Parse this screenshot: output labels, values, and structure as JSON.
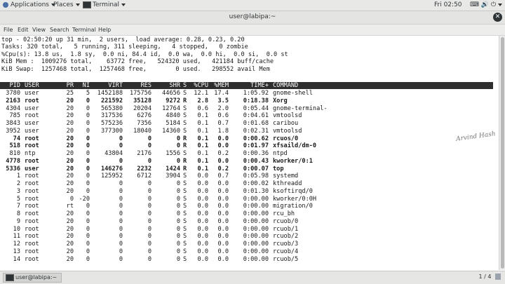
{
  "topbar": {
    "applications": "Applications",
    "places": "Places",
    "terminal": "Terminal",
    "clock": "Fri 02:50"
  },
  "window": {
    "title": "user@labipa:~"
  },
  "menu": [
    "File",
    "Edit",
    "View",
    "Search",
    "Terminal",
    "Help"
  ],
  "summary": [
    "top - 02:50:20 up 31 min,  2 users,  load average: 0.28, 0.23, 0.20",
    "Tasks: 320 total,   5 running, 311 sleeping,   4 stopped,   0 zombie",
    "%Cpu(s): 13.8 us,  1.8 sy,  0.0 ni, 84.4 id,  0.0 wa,  0.0 hi,  0.0 si,  0.0 st",
    "KiB Mem :  1009276 total,    63772 free,   524320 used,   421184 buff/cache",
    "KiB Swap:  1257468 total,  1257468 free,        0 used.   298552 avail Mem"
  ],
  "columns": [
    "PID",
    "USER",
    "PR",
    "NI",
    "VIRT",
    "RES",
    "SHR",
    "S",
    "%CPU",
    "%MEM",
    "TIME+",
    "COMMAND"
  ],
  "processes": [
    {
      "pid": "3780",
      "user": "user",
      "pr": "25",
      "ni": "5",
      "virt": "1452188",
      "res": "175756",
      "shr": "44656",
      "s": "S",
      "cpu": "12.1",
      "mem": "17.4",
      "time": "1:05.92",
      "cmd": "gnome-shell",
      "bold": false
    },
    {
      "pid": "2163",
      "user": "root",
      "pr": "20",
      "ni": "0",
      "virt": "221592",
      "res": "35128",
      "shr": "9272",
      "s": "R",
      "cpu": "2.8",
      "mem": "3.5",
      "time": "0:18.38",
      "cmd": "Xorg",
      "bold": true
    },
    {
      "pid": "4304",
      "user": "user",
      "pr": "20",
      "ni": "0",
      "virt": "565380",
      "res": "20204",
      "shr": "12764",
      "s": "S",
      "cpu": "0.6",
      "mem": "2.0",
      "time": "0:05.44",
      "cmd": "gnome-terminal-",
      "bold": false
    },
    {
      "pid": "785",
      "user": "root",
      "pr": "20",
      "ni": "0",
      "virt": "317536",
      "res": "6276",
      "shr": "4840",
      "s": "S",
      "cpu": "0.1",
      "mem": "0.6",
      "time": "0:04.61",
      "cmd": "vmtoolsd",
      "bold": false
    },
    {
      "pid": "3843",
      "user": "user",
      "pr": "20",
      "ni": "0",
      "virt": "575236",
      "res": "7356",
      "shr": "5184",
      "s": "S",
      "cpu": "0.1",
      "mem": "0.7",
      "time": "0:01.68",
      "cmd": "caribou",
      "bold": false
    },
    {
      "pid": "3952",
      "user": "user",
      "pr": "20",
      "ni": "0",
      "virt": "377300",
      "res": "18040",
      "shr": "14360",
      "s": "S",
      "cpu": "0.1",
      "mem": "1.8",
      "time": "0:02.31",
      "cmd": "vmtoolsd",
      "bold": false
    },
    {
      "pid": "74",
      "user": "root",
      "pr": "20",
      "ni": "0",
      "virt": "0",
      "res": "0",
      "shr": "0",
      "s": "R",
      "cpu": "0.1",
      "mem": "0.0",
      "time": "0:00.62",
      "cmd": "rcuos/0",
      "bold": true
    },
    {
      "pid": "518",
      "user": "root",
      "pr": "20",
      "ni": "0",
      "virt": "0",
      "res": "0",
      "shr": "0",
      "s": "R",
      "cpu": "0.1",
      "mem": "0.0",
      "time": "0:01.97",
      "cmd": "xfsaild/dm-0",
      "bold": true
    },
    {
      "pid": "810",
      "user": "ntp",
      "pr": "20",
      "ni": "0",
      "virt": "43804",
      "res": "2176",
      "shr": "1556",
      "s": "S",
      "cpu": "0.1",
      "mem": "0.2",
      "time": "0:00.36",
      "cmd": "ntpd",
      "bold": false
    },
    {
      "pid": "4778",
      "user": "root",
      "pr": "20",
      "ni": "0",
      "virt": "0",
      "res": "0",
      "shr": "0",
      "s": "R",
      "cpu": "0.1",
      "mem": "0.0",
      "time": "0:00.43",
      "cmd": "kworker/0:1",
      "bold": true
    },
    {
      "pid": "5336",
      "user": "user",
      "pr": "20",
      "ni": "0",
      "virt": "146276",
      "res": "2232",
      "shr": "1424",
      "s": "R",
      "cpu": "0.1",
      "mem": "0.2",
      "time": "0:00.07",
      "cmd": "top",
      "bold": true
    },
    {
      "pid": "1",
      "user": "root",
      "pr": "20",
      "ni": "0",
      "virt": "125952",
      "res": "6712",
      "shr": "3904",
      "s": "S",
      "cpu": "0.0",
      "mem": "0.7",
      "time": "0:05.98",
      "cmd": "systemd",
      "bold": false
    },
    {
      "pid": "2",
      "user": "root",
      "pr": "20",
      "ni": "0",
      "virt": "0",
      "res": "0",
      "shr": "0",
      "s": "S",
      "cpu": "0.0",
      "mem": "0.0",
      "time": "0:00.02",
      "cmd": "kthreadd",
      "bold": false
    },
    {
      "pid": "3",
      "user": "root",
      "pr": "20",
      "ni": "0",
      "virt": "0",
      "res": "0",
      "shr": "0",
      "s": "S",
      "cpu": "0.0",
      "mem": "0.0",
      "time": "0:01.30",
      "cmd": "ksoftirqd/0",
      "bold": false
    },
    {
      "pid": "5",
      "user": "root",
      "pr": "0",
      "ni": "-20",
      "virt": "0",
      "res": "0",
      "shr": "0",
      "s": "S",
      "cpu": "0.0",
      "mem": "0.0",
      "time": "0:00.00",
      "cmd": "kworker/0:0H",
      "bold": false
    },
    {
      "pid": "7",
      "user": "root",
      "pr": "rt",
      "ni": "0",
      "virt": "0",
      "res": "0",
      "shr": "0",
      "s": "S",
      "cpu": "0.0",
      "mem": "0.0",
      "time": "0:00.00",
      "cmd": "migration/0",
      "bold": false
    },
    {
      "pid": "8",
      "user": "root",
      "pr": "20",
      "ni": "0",
      "virt": "0",
      "res": "0",
      "shr": "0",
      "s": "S",
      "cpu": "0.0",
      "mem": "0.0",
      "time": "0:00.00",
      "cmd": "rcu_bh",
      "bold": false
    },
    {
      "pid": "9",
      "user": "root",
      "pr": "20",
      "ni": "0",
      "virt": "0",
      "res": "0",
      "shr": "0",
      "s": "S",
      "cpu": "0.0",
      "mem": "0.0",
      "time": "0:00.00",
      "cmd": "rcuob/0",
      "bold": false
    },
    {
      "pid": "10",
      "user": "root",
      "pr": "20",
      "ni": "0",
      "virt": "0",
      "res": "0",
      "shr": "0",
      "s": "S",
      "cpu": "0.0",
      "mem": "0.0",
      "time": "0:00.00",
      "cmd": "rcuob/1",
      "bold": false
    },
    {
      "pid": "11",
      "user": "root",
      "pr": "20",
      "ni": "0",
      "virt": "0",
      "res": "0",
      "shr": "0",
      "s": "S",
      "cpu": "0.0",
      "mem": "0.0",
      "time": "0:00.00",
      "cmd": "rcuob/2",
      "bold": false
    },
    {
      "pid": "12",
      "user": "root",
      "pr": "20",
      "ni": "0",
      "virt": "0",
      "res": "0",
      "shr": "0",
      "s": "S",
      "cpu": "0.0",
      "mem": "0.0",
      "time": "0:00.00",
      "cmd": "rcuob/3",
      "bold": false
    },
    {
      "pid": "13",
      "user": "root",
      "pr": "20",
      "ni": "0",
      "virt": "0",
      "res": "0",
      "shr": "0",
      "s": "S",
      "cpu": "0.0",
      "mem": "0.0",
      "time": "0:00.00",
      "cmd": "rcuob/4",
      "bold": false
    },
    {
      "pid": "14",
      "user": "root",
      "pr": "20",
      "ni": "0",
      "virt": "0",
      "res": "0",
      "shr": "0",
      "s": "S",
      "cpu": "0.0",
      "mem": "0.0",
      "time": "0:00.00",
      "cmd": "rcuob/5",
      "bold": false
    }
  ],
  "watermark": "Arvind Hash",
  "taskbar": {
    "task_label": "user@labipa:~",
    "pager": "1 / 4"
  }
}
